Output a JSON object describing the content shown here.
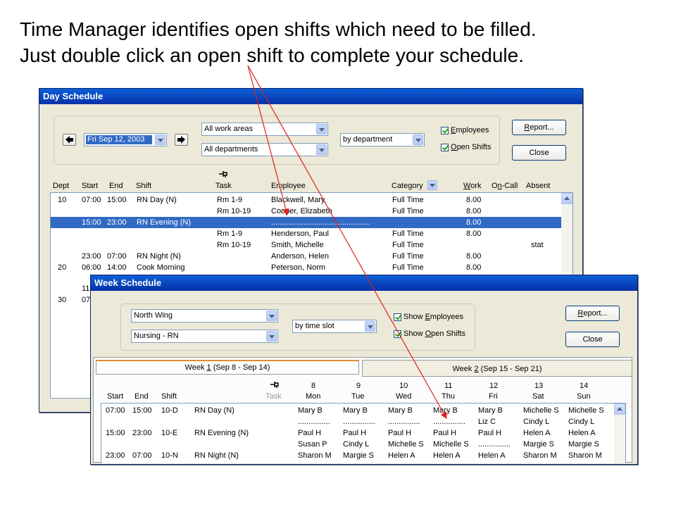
{
  "caption": {
    "line1": "Time Manager identifies open shifts which need to be filled.",
    "line2": "Just double click an open shift to complete your schedule."
  },
  "day": {
    "title": "Day Schedule",
    "date": "Fri Sep 12, 2003",
    "area": "All work areas",
    "dept": "All departments",
    "grouping": "by department",
    "employees_label": "mployees",
    "employees_u": "E",
    "open_label": "pen Shifts",
    "open_u": "O",
    "report": "eport...",
    "report_u": "R",
    "close": "Close",
    "headers": {
      "dept": "Dept",
      "start": "Start",
      "end": "End",
      "shift": "Shift",
      "task": "Task",
      "employee": "Employee",
      "category": "Category",
      "work_u": "W",
      "work": "ork",
      "oncall_a": "O",
      "oncall_u": "n",
      "oncall_b": "-Call",
      "absent": "Absent"
    },
    "rows": [
      {
        "dept": "10",
        "start": "07:00",
        "end": "15:00",
        "shift": "RN Day (N)",
        "task": "Rm 1-9",
        "employee": "Blackwell, Mary",
        "category": "Full Time",
        "work": "8.00",
        "absent": ""
      },
      {
        "dept": "",
        "start": "",
        "end": "",
        "shift": "",
        "task": "Rm 10-19",
        "employee": "Cooper, Elizabeth",
        "category": "Full Time",
        "work": "8.00",
        "absent": ""
      },
      {
        "dept": "",
        "start": "15:00",
        "end": "23:00",
        "shift": "RN Evening (N)",
        "task": "",
        "employee": "..............................................",
        "category": "",
        "work": "8.00",
        "absent": ""
      },
      {
        "dept": "",
        "start": "",
        "end": "",
        "shift": "",
        "task": "Rm 1-9",
        "employee": "Henderson, Paul",
        "category": "Full Time",
        "work": "8.00",
        "absent": ""
      },
      {
        "dept": "",
        "start": "",
        "end": "",
        "shift": "",
        "task": "Rm 10-19",
        "employee": "Smith, Michelle",
        "category": "Full Time",
        "work": "",
        "absent": "stat"
      },
      {
        "dept": "",
        "start": "23:00",
        "end": "07:00",
        "shift": "RN Night (N)",
        "task": "",
        "employee": "Anderson, Helen",
        "category": "Full Time",
        "work": "8.00",
        "absent": ""
      },
      {
        "dept": "20",
        "start": "06:00",
        "end": "14:00",
        "shift": "Cook Morning",
        "task": "",
        "employee": "Peterson, Norm",
        "category": "Full Time",
        "work": "8.00",
        "absent": ""
      },
      {
        "dept": "",
        "start": "11:",
        "end": "",
        "shift": "",
        "task": "",
        "employee": "",
        "category": "",
        "work": "",
        "absent": ""
      },
      {
        "dept": "30",
        "start": "07:",
        "end": "",
        "shift": "",
        "task": "",
        "employee": "",
        "category": "",
        "work": "",
        "absent": ""
      }
    ]
  },
  "week": {
    "title": "Week Schedule",
    "area": "North Wing",
    "dept": "Nursing - RN",
    "grouping": "by time slot",
    "show_emp_a": "Show ",
    "show_emp_u": "E",
    "show_emp_b": "mployees",
    "show_open_a": "Show ",
    "show_open_u": "O",
    "show_open_b": "pen Shifts",
    "report_u": "R",
    "report": "eport...",
    "close": "Close",
    "tab1_a": "Week ",
    "tab1_u": "1",
    "tab1_b": "  (Sep 8 - Sep 14)",
    "tab2_a": "Week ",
    "tab2_u": "2",
    "tab2_b": "  (Sep 15 - Sep 21)",
    "headers": {
      "start": "Start",
      "end": "End",
      "shift": "Shift",
      "task": "Task"
    },
    "days": [
      {
        "num": "8",
        "name": "Mon"
      },
      {
        "num": "9",
        "name": "Tue"
      },
      {
        "num": "10",
        "name": "Wed"
      },
      {
        "num": "11",
        "name": "Thu"
      },
      {
        "num": "12",
        "name": "Fri"
      },
      {
        "num": "13",
        "name": "Sat"
      },
      {
        "num": "14",
        "name": "Sun"
      }
    ],
    "rows": [
      {
        "start": "07:00",
        "end": "15:00",
        "shift": "10-D",
        "name": "RN Day (N)",
        "cells": [
          "Mary B",
          "Mary B",
          "Mary B",
          "Mary B",
          "Mary B",
          "Michelle S",
          "Michelle S"
        ]
      },
      {
        "start": "",
        "end": "",
        "shift": "",
        "name": "",
        "cells": [
          "...............",
          "...............",
          "...............",
          "...............",
          "Liz C",
          "Cindy L",
          "Cindy L"
        ]
      },
      {
        "start": "15:00",
        "end": "23:00",
        "shift": "10-E",
        "name": "RN Evening (N)",
        "cells": [
          "Paul H",
          "Paul H",
          "Paul H",
          "Paul H",
          "Paul H",
          "Helen A",
          "Helen A"
        ]
      },
      {
        "start": "",
        "end": "",
        "shift": "",
        "name": "",
        "cells": [
          "Susan P",
          "Cindy L",
          "Michelle S",
          "Michelle S",
          "...............",
          "Margie S",
          "Margie S"
        ]
      },
      {
        "start": "23:00",
        "end": "07:00",
        "shift": "10-N",
        "name": "RN Night (N)",
        "cells": [
          "Sharon M",
          "Margie S",
          "Helen A",
          "Helen A",
          "Helen A",
          "Sharon M",
          "Sharon M"
        ]
      }
    ]
  },
  "colors": {
    "annotation": "#e0201c",
    "selection": "#316ac5",
    "titlebar": "#0a5fd8"
  },
  "icons": {
    "prev": "left-arrow-icon",
    "next": "right-arrow-icon",
    "task": "pushpin-icon",
    "filter": "filter-dropdown-icon"
  }
}
